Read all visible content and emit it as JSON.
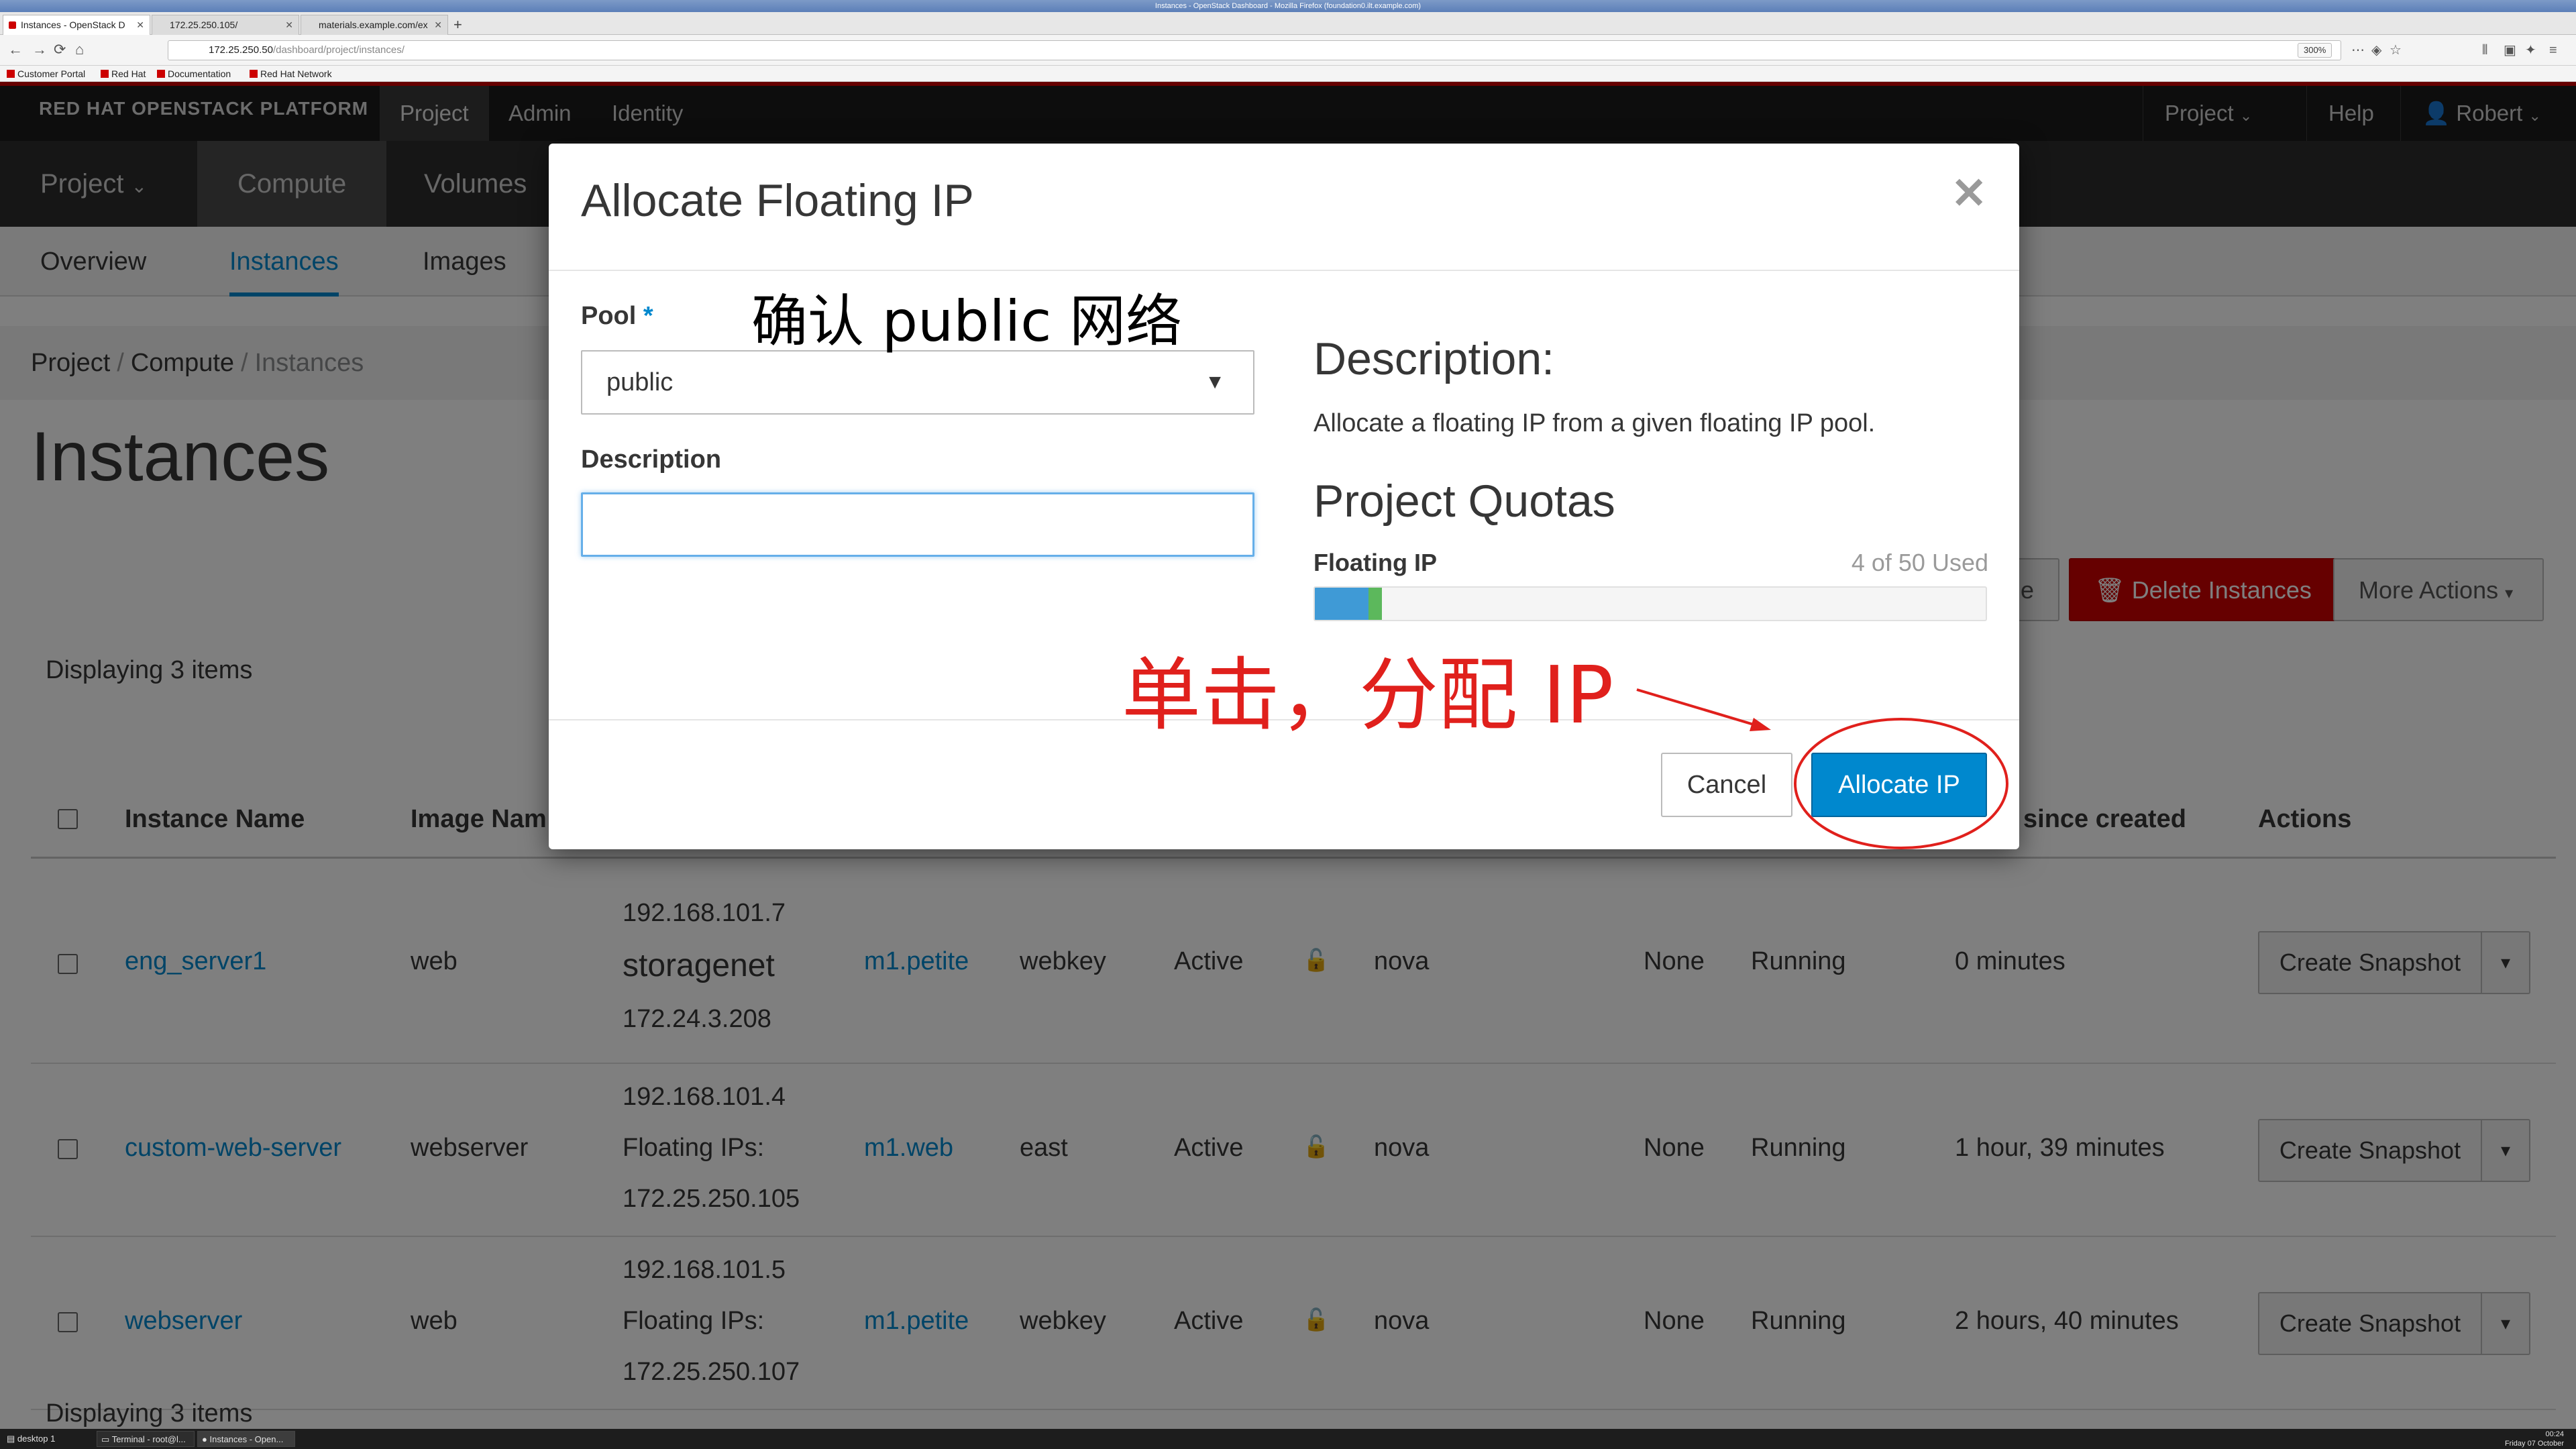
{
  "browser": {
    "window_title": "Instances - OpenStack Dashboard - Mozilla Firefox (foundation0.ilt.example.com)",
    "tabs": [
      {
        "label": "Instances - OpenStack D",
        "active": true
      },
      {
        "label": "172.25.250.105/",
        "active": false
      },
      {
        "label": "materials.example.com/ex",
        "active": false
      }
    ],
    "url_host": "172.25.250.50",
    "url_path": "/dashboard/project/instances/",
    "zoom": "300%",
    "bookmarks": [
      "Customer Portal",
      "Red Hat",
      "Documentation",
      "Red Hat Network"
    ]
  },
  "topnav": {
    "brand": "RED HAT OPENSTACK PLATFORM",
    "links": [
      "Project",
      "Admin",
      "Identity"
    ],
    "project_menu": "Project",
    "help": "Help",
    "user": "Robert"
  },
  "subnav": {
    "items": [
      "Project",
      "Compute",
      "Volumes"
    ]
  },
  "page_tabs": [
    "Overview",
    "Instances",
    "Images"
  ],
  "breadcrumb": [
    "Project",
    "Compute",
    "Instances"
  ],
  "page_title": "Instances",
  "actions": {
    "partial_button": "e",
    "delete": "Delete Instances",
    "more": "More Actions"
  },
  "table": {
    "count_text": "Displaying 3 items",
    "headers": {
      "name": "Instance Name",
      "image": "Image Nam",
      "age": "since created",
      "actions": "Actions"
    },
    "rows": [
      {
        "name": "eng_server1",
        "image": "web",
        "ip_lines": [
          "192.168.101.7",
          "storagenet",
          "172.24.3.208"
        ],
        "size": "m1.petite",
        "keypair": "webkey",
        "status": "Active",
        "zone": "nova",
        "task": "None",
        "power": "Running",
        "age": "0 minutes",
        "action": "Create Snapshot"
      },
      {
        "name": "custom-web-server",
        "image": "webserver",
        "ip_lines": [
          "192.168.101.4",
          "Floating IPs:",
          "172.25.250.105"
        ],
        "size": "m1.web",
        "keypair": "east",
        "status": "Active",
        "zone": "nova",
        "task": "None",
        "power": "Running",
        "age": "1 hour, 39 minutes",
        "action": "Create Snapshot"
      },
      {
        "name": "webserver",
        "image": "web",
        "ip_lines": [
          "192.168.101.5",
          "Floating IPs:",
          "172.25.250.107"
        ],
        "size": "m1.petite",
        "keypair": "webkey",
        "status": "Active",
        "zone": "nova",
        "task": "None",
        "power": "Running",
        "age": "2 hours, 40 minutes",
        "action": "Create Snapshot"
      }
    ]
  },
  "modal": {
    "title": "Allocate Floating IP",
    "close_icon": "close-icon",
    "pool_label": "Pool",
    "pool_required": "*",
    "pool_value": "public",
    "description_label": "Description",
    "description_value": "",
    "help_title": "Description:",
    "help_text": "Allocate a floating IP from a given floating IP pool.",
    "quota_title": "Project Quotas",
    "quota_label": "Floating IP",
    "quota_used_text": "4 of 50 Used",
    "quota_used": 4,
    "quota_total": 50,
    "quota_adding": 1,
    "cancel": "Cancel",
    "allocate": "Allocate IP"
  },
  "annotations": {
    "pool_note": "确认 public 网络",
    "click_note": "单击，分配 IP",
    "color": "#e0201c"
  },
  "taskbar": {
    "items": [
      "desktop 1",
      "Terminal - root@l...",
      "Instances - Open..."
    ],
    "clock_time": "00:24",
    "clock_date": "Friday 07 October"
  },
  "colors": {
    "accent": "#0088ce",
    "danger": "#cc0000",
    "nav_dark": "#1a1a1a"
  }
}
